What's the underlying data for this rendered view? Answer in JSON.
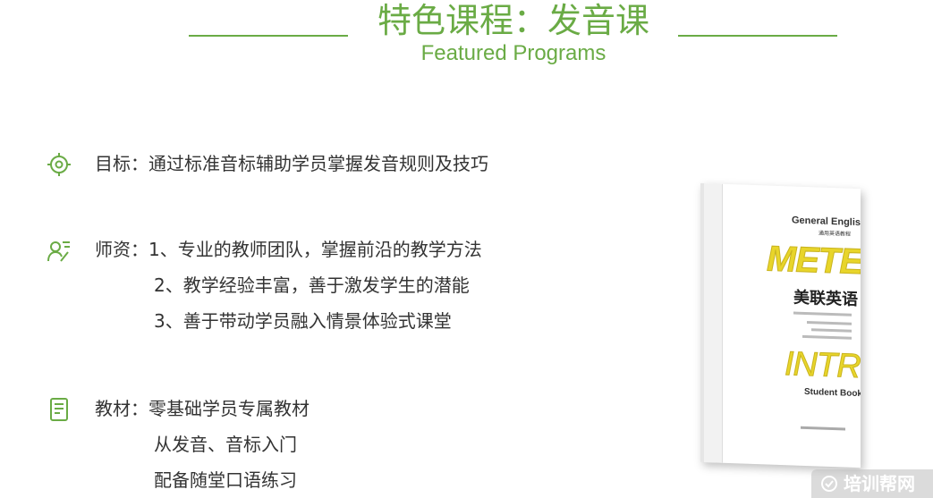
{
  "header": {
    "title": "特色课程：发音课",
    "subtitle": "Featured Programs"
  },
  "sections": [
    {
      "icon": "target-icon",
      "lines": [
        "目标：通过标准音标辅助学员掌握发音规则及技巧"
      ]
    },
    {
      "icon": "teacher-icon",
      "lines": [
        "师资：1、专业的教师团队，掌握前沿的教学方法",
        "2、教学经验丰富，善于激发学生的潜能",
        "3、善于带动学员融入情景体验式课堂"
      ]
    },
    {
      "icon": "book-icon",
      "lines": [
        "教材：零基础学员专属教材",
        "从发音、音标入门",
        "配备随堂口语练习"
      ]
    }
  ],
  "book_cover": {
    "series": "General English",
    "series_zh": "通用英语教程",
    "brand": "METEN",
    "brand_zh": "美联英语",
    "level": "INTRO",
    "book_type": "Student Book"
  },
  "watermark": {
    "text": "培训帮网"
  },
  "colors": {
    "accent": "#6aab45",
    "text": "#333333",
    "cover_yellow": "#e8d52a"
  }
}
